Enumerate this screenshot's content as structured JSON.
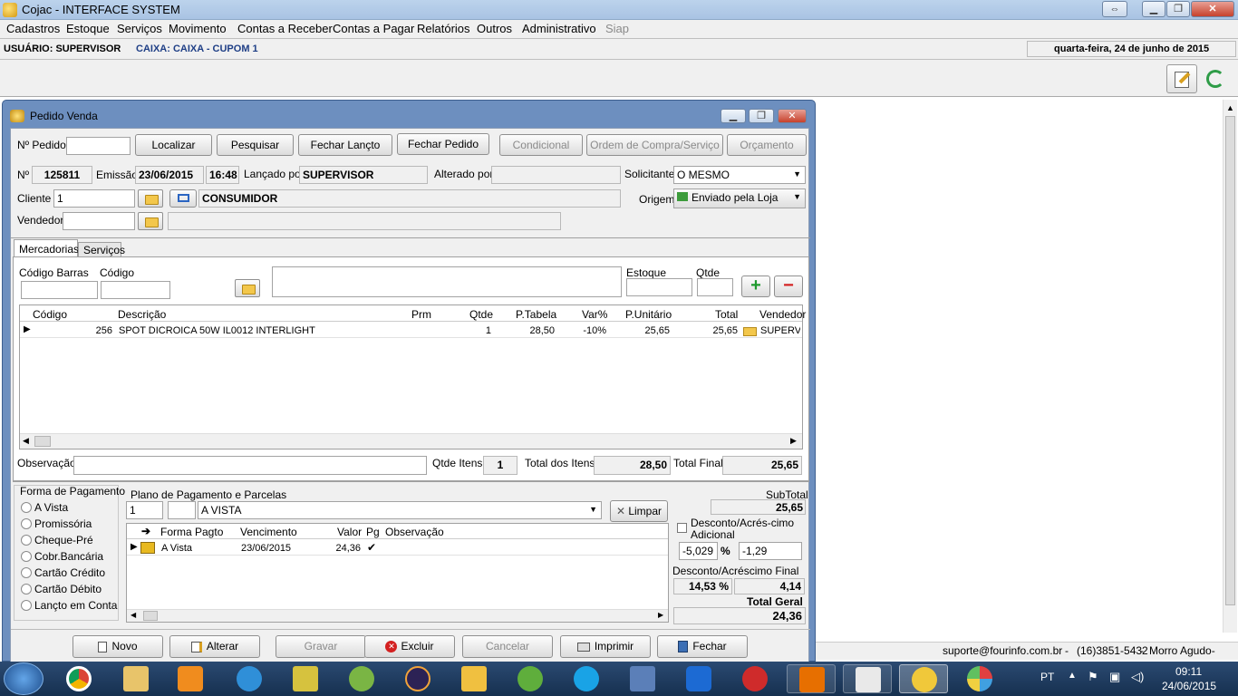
{
  "app": {
    "title": "Cojac - INTERFACE SYSTEM"
  },
  "menu": [
    "Cadastros",
    "Estoque",
    "Serviços",
    "Movimento",
    "Contas a Receber",
    "Contas a Pagar",
    "Relatórios",
    "Outros",
    "Administrativo",
    "Siap"
  ],
  "status": {
    "user": "USUÁRIO: SUPERVISOR",
    "caixa": "CAIXA: CAIXA - CUPOM 1",
    "date": "quarta-feira, 24 de junho de 2015"
  },
  "window": {
    "title": "Pedido Venda"
  },
  "top_buttons": {
    "pedido_label": "Nº Pedido",
    "localizar": "Localizar",
    "pesquisar": "Pesquisar",
    "fechar_lancto": "Fechar Lançto",
    "fechar_pedido": "Fechar Pedido",
    "condicional": "Condicional",
    "ordem": "Ordem de Compra/Serviço",
    "orcamento": "Orçamento"
  },
  "header": {
    "no_label": "Nº",
    "no": "125811",
    "emissao_label": "Emissão",
    "emissao": "23/06/2015",
    "hora": "16:48",
    "lancado_label": "Lançado por",
    "lancado": "SUPERVISOR",
    "alterado_label": "Alterado por",
    "alterado": "",
    "solicitante_label": "Solicitante",
    "solicitante": "O MESMO",
    "cliente_label": "Cliente",
    "cliente": "1",
    "cliente_nome": "CONSUMIDOR",
    "origem_label": "Origem",
    "origem": "Enviado pela Loja",
    "vendedor_label": "Vendedor",
    "vendedor": ""
  },
  "tabs": [
    "Mercadorias",
    "Serviços"
  ],
  "item_entry": {
    "codigo_barras": "Código Barras",
    "codigo": "Código",
    "estoque": "Estoque",
    "qtde": "Qtde"
  },
  "items": {
    "columns": [
      "Código",
      "Descrição",
      "Prm",
      "Qtde",
      "P.Tabela",
      "Var%",
      "P.Unitário",
      "Total",
      "Vendedor"
    ],
    "rows": [
      {
        "codigo": "256",
        "descricao": "SPOT DICROICA 50W IL0012 INTERLIGHT",
        "prm": "",
        "qtde": "1",
        "ptabela": "28,50",
        "var": "-10%",
        "punit": "25,65",
        "total": "25,65",
        "vendedor": "SUPERVIS"
      }
    ]
  },
  "totals": {
    "obs_label": "Observação",
    "qtde_itens_label": "Qtde Itens",
    "qtde_itens": "1",
    "total_itens_label": "Total dos Itens",
    "total_itens": "28,50",
    "total_final_label": "Total Final",
    "total_final": "25,65"
  },
  "payment": {
    "forma_label": "Forma de Pagamento",
    "formas": [
      "A Vista",
      "Promissória",
      "Cheque-Pré",
      "Cobr.Bancária",
      "Cartão Crédito",
      "Cartão Débito",
      "Lançto em Conta"
    ],
    "plano_label": "Plano de Pagamento e Parcelas",
    "plano_cod": "1",
    "plano_nome": "A VISTA",
    "limpar": "Limpar",
    "columns": [
      "Forma Pagto",
      "Vencimento",
      "Valor",
      "Pg",
      "Observação"
    ],
    "rows": [
      {
        "forma": "A Vista",
        "venc": "23/06/2015",
        "valor": "24,36",
        "pg": "✔",
        "obs": ""
      }
    ]
  },
  "summary": {
    "subtotal_label": "SubTotal",
    "subtotal": "25,65",
    "desconto_label": "Desconto/Acrés-cimo Adicional",
    "desc_pct": "-5,029",
    "pct": "%",
    "desc_val": "-1,29",
    "desc_final_label": "Desconto/Acréscimo Final",
    "desc_final_pct": "14,53 %",
    "desc_final_val": "4,14",
    "total_geral_label": "Total Geral",
    "total_geral": "24,36"
  },
  "bottom_buttons": {
    "novo": "Novo",
    "alterar": "Alterar",
    "gravar": "Gravar",
    "excluir": "Excluir",
    "cancelar": "Cancelar",
    "imprimir": "Imprimir",
    "fechar": "Fechar"
  },
  "footer": {
    "email": "suporte@fourinfo.com.br",
    "phone": "(16)3851-5432",
    "city": "Morro Agudo-"
  },
  "taskbar": {
    "lang": "PT",
    "time": "09:11",
    "date": "24/06/2015"
  }
}
